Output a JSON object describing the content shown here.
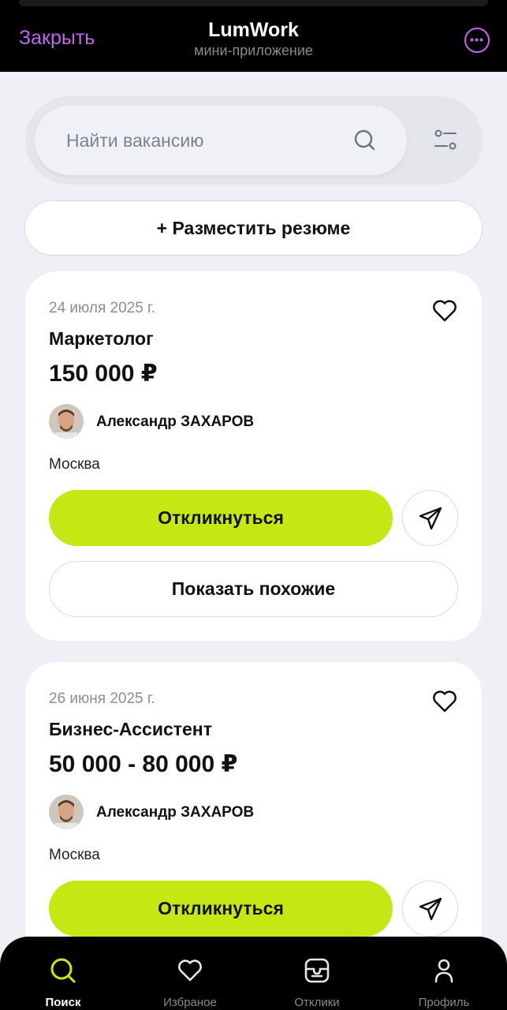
{
  "header": {
    "close_label": "Закрыть",
    "title": "LumWork",
    "subtitle": "мини-приложение",
    "more_icon": "more-icon",
    "accent_color": "#c266f0"
  },
  "search": {
    "placeholder": "Найти вакансию",
    "value": "",
    "search_icon": "search-icon",
    "filter_icon": "filter-icon"
  },
  "resume_button": "+ Разместить резюме",
  "jobs": [
    {
      "date": "24 июля 2025 г.",
      "title": "Маркетолог",
      "salary": "150 000 ₽",
      "author": "Александр ЗАХАРОВ",
      "city": "Москва",
      "apply_label": "Откликнуться",
      "similar_label": "Показать похожие"
    },
    {
      "date": "26 июня 2025 г.",
      "title": "Бизнес-Ассистент",
      "salary": "50 000 - 80 000 ₽",
      "author": "Александр ЗАХАРОВ",
      "city": "Москва",
      "apply_label": "Откликнуться"
    }
  ],
  "bottom_nav": [
    {
      "label": "Поиск",
      "icon": "search-icon",
      "active": true
    },
    {
      "label": "Избраное",
      "icon": "heart-icon",
      "active": false
    },
    {
      "label": "Отклики",
      "icon": "responses-icon",
      "active": false
    },
    {
      "label": "Профиль",
      "icon": "profile-icon",
      "active": false
    }
  ],
  "colors": {
    "accent_green": "#c5e814",
    "background": "#eef0f5"
  }
}
